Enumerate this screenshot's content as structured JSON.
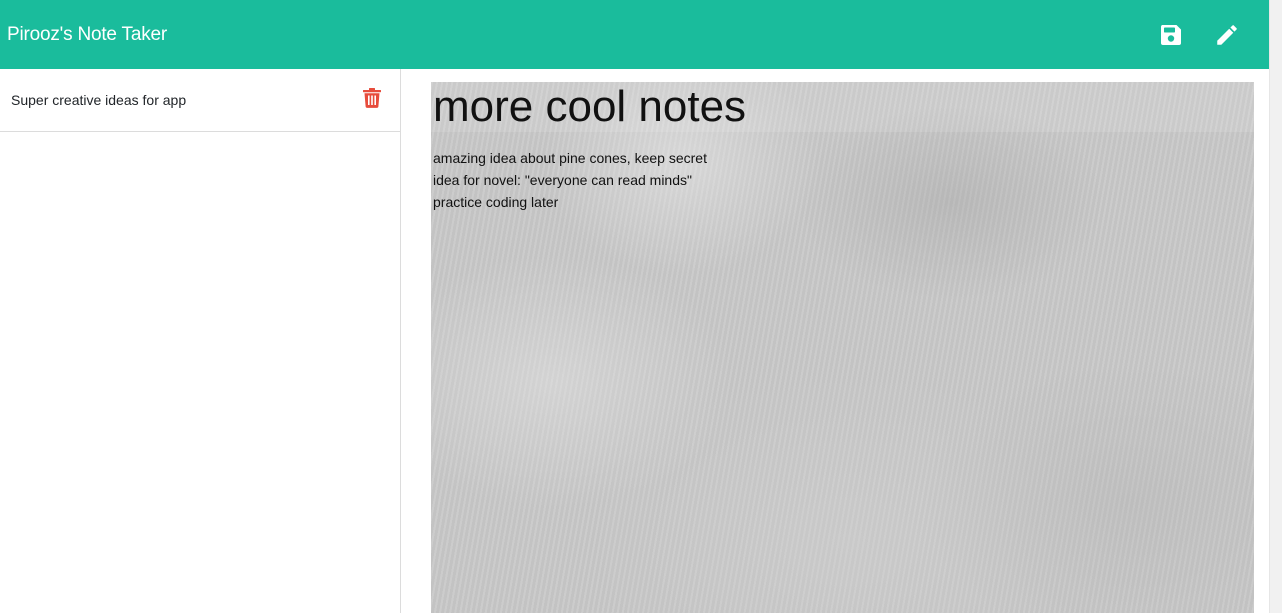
{
  "navbar": {
    "brand": "Pirooz's Note Taker",
    "save_icon": "save-icon",
    "new_note_icon": "pencil-icon",
    "background_color": "#1abc9c"
  },
  "sidebar": {
    "notes": [
      {
        "title": "Super creative ideas for app",
        "delete_icon": "trash-icon",
        "delete_icon_color": "#e74c3c"
      }
    ]
  },
  "editor": {
    "title": "more cool notes",
    "text": "amazing idea about pine cones, keep secret\nidea for novel: \"everyone can read minds\"\npractice coding later"
  }
}
